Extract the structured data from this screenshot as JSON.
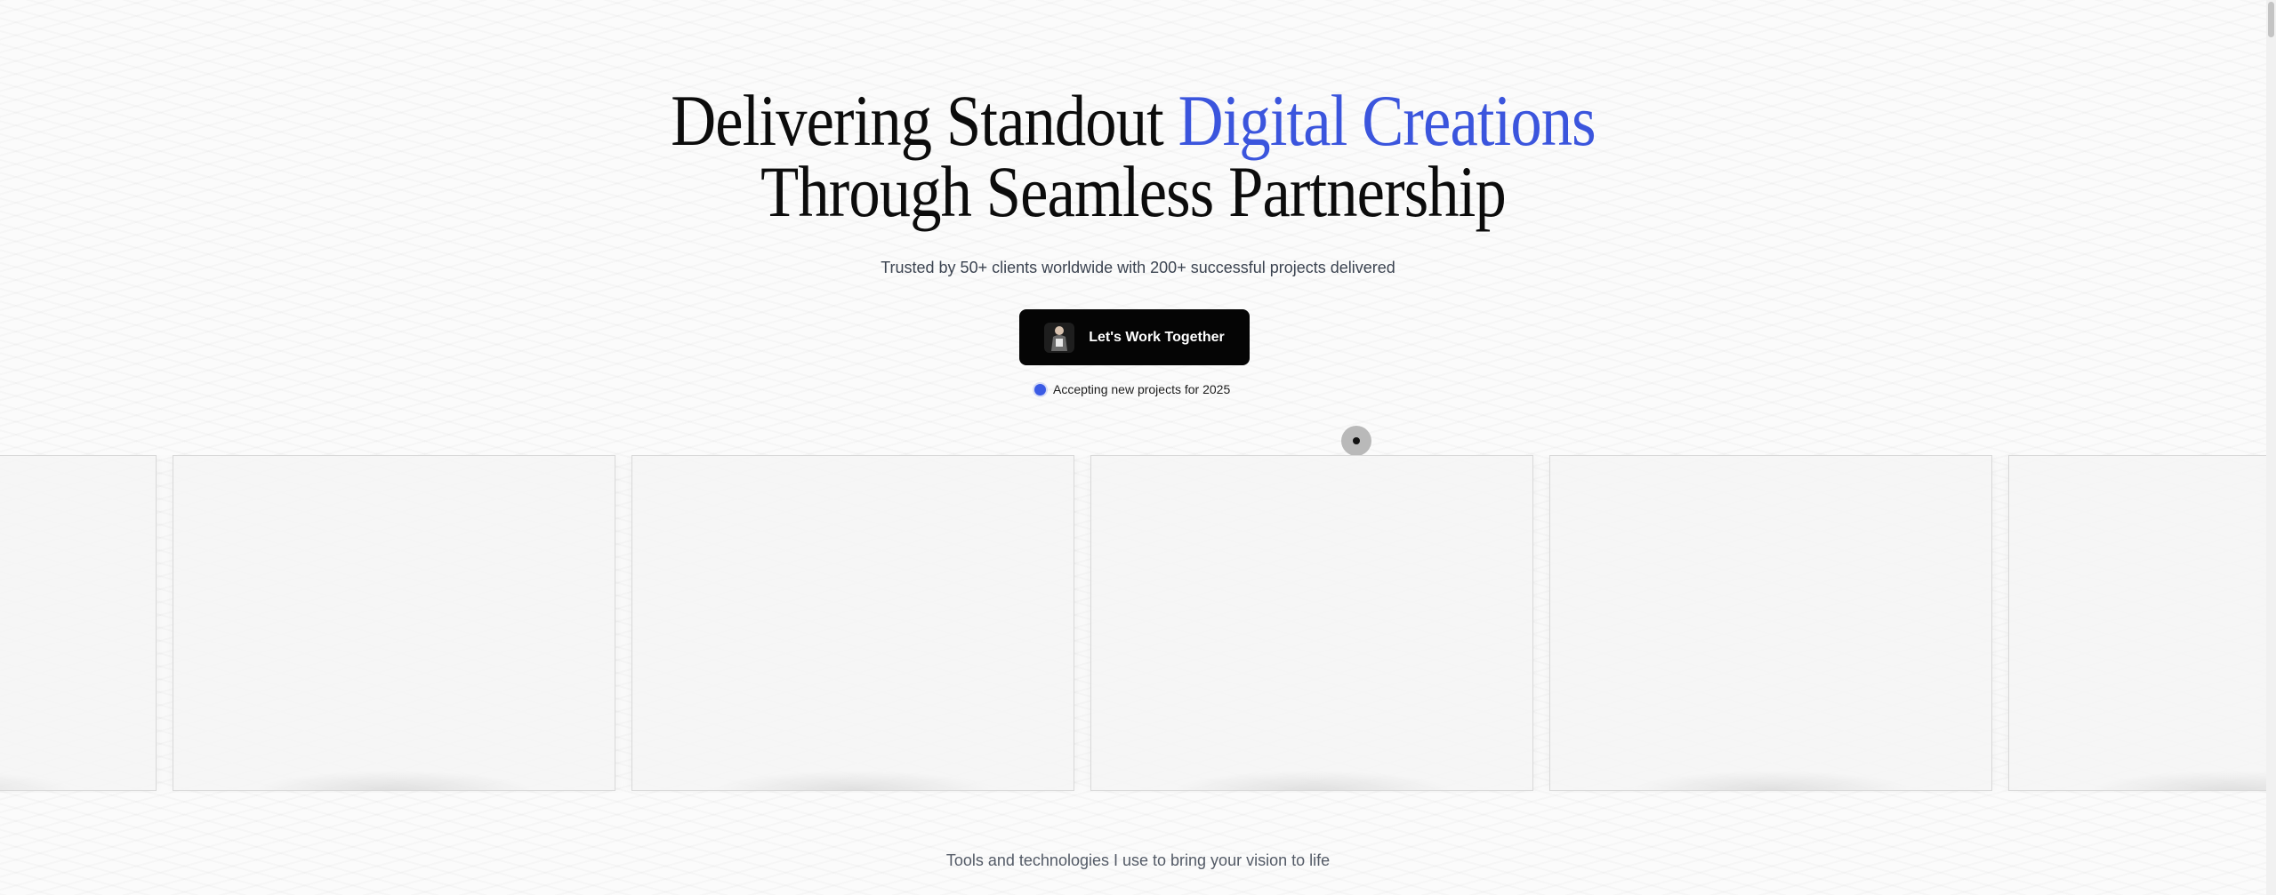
{
  "hero": {
    "headline_part1": "Delivering Standout ",
    "headline_accent": "Digital Creations",
    "headline_line2": "Through Seamless Partnership",
    "subline": "Trusted by 50+ clients worldwide with 200+ successful projects delivered",
    "cta_label": "Let's Work Together",
    "status_text": "Accepting new projects for 2025"
  },
  "carousel": {
    "card_count": 6
  },
  "tools": {
    "subtitle": "Tools and technologies I use to bring your vision to life"
  },
  "colors": {
    "accent": "#3b55dd",
    "button": "#050505",
    "status_dot": "#3b5be5"
  },
  "icons": [
    "avatar-image-icon",
    "status-dot-icon",
    "cursor-indicator-icon"
  ]
}
